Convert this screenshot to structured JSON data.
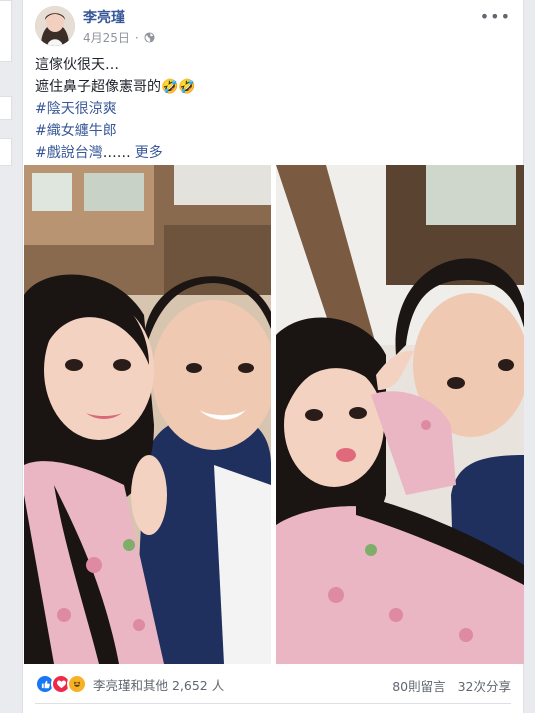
{
  "post": {
    "author": "李亮瑾",
    "date": "4月25日",
    "privacy_icon": "globe-icon",
    "menu_icon": "more-dots-icon",
    "text_line1": "這傢伙很天…",
    "text_line2": "遮住鼻子超像憲哥的🤣🤣",
    "hashtag1": "#陰天很涼爽",
    "hashtag2": "#織女纏牛郎",
    "hashtag3": "#戲說台灣",
    "ellipsis": "……",
    "see_more": "更多"
  },
  "footer": {
    "reaction_icons": [
      "like-icon",
      "love-icon",
      "haha-icon"
    ],
    "reactions_label": "李亮瑾和其他 2,652 人",
    "comments": "80則留言",
    "shares": "32次分享"
  },
  "colors": {
    "link": "#385898",
    "like": "#1877f2",
    "love": "#f0284a",
    "haha": "#f7b125"
  }
}
